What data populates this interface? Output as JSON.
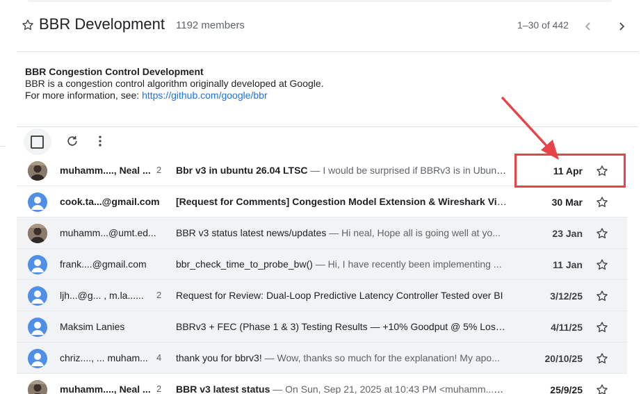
{
  "header": {
    "title": "BBR Development",
    "members": "1192 members",
    "range": "1–30 of 442"
  },
  "about": {
    "title": "BBR Congestion Control Development",
    "line1": "BBR is a congestion control algorithm originally developed at Google.",
    "line2_prefix": "For more information, see: ",
    "link": "https://github.com/google/bbr"
  },
  "icons": {
    "favorite": "star-outline-icon",
    "prev": "chevron-left-icon",
    "next": "chevron-right-icon",
    "refresh": "refresh-icon",
    "more": "more-vert-icon",
    "avatar": "person-icon"
  },
  "colors": {
    "link": "#1a73e8",
    "avatar_default": "#4f8fe8",
    "highlight": "#e8434a"
  },
  "threads": [
    {
      "sender": "muhamm...., Neal ...",
      "count": "2",
      "subject": "Bbr v3 in ubuntu 26.04 LTSC",
      "snippet": " — I would be surprised if BBRv3 is in Ubunt...",
      "date": "11 Apr",
      "unread": true,
      "avatar": "photo"
    },
    {
      "sender": "cook.ta...@gmail.com",
      "count": "",
      "subject": "[Request for Comments] Congestion Model Extension & Wireshark Visuali",
      "snippet": "",
      "date": "30 Mar",
      "unread": true,
      "avatar": "default"
    },
    {
      "sender": "muhamm...@umt.ed...",
      "count": "",
      "subject": "BBR v3 status latest news/updates",
      "snippet": " — Hi neal, Hope all is going well at yo...",
      "date": "23 Jan",
      "unread": false,
      "avatar": "photo"
    },
    {
      "sender": "frank....@gmail.com",
      "count": "",
      "subject": "bbr_check_time_to_probe_bw()",
      "snippet": " — Hi, I have recently been implementing ...",
      "date": "11 Jan",
      "unread": false,
      "avatar": "default"
    },
    {
      "sender": "ljh...@g...  , m.la......",
      "count": "2",
      "subject": "Request for Review: Dual-Loop Predictive Latency Controller Tested over BI",
      "snippet": "",
      "date": "3/12/25",
      "unread": false,
      "avatar": "default"
    },
    {
      "sender": "Maksim Lanies",
      "count": "",
      "subject": "BBRv3 + FEC (Phase 1 & 3) Testing Results — +10% Goodput @ 5% Loss ...",
      "snippet": "",
      "date": "4/11/25",
      "unread": false,
      "avatar": "default"
    },
    {
      "sender": "chriz...., ... muham...",
      "count": "4",
      "subject": "thank you for bbrv3!",
      "snippet": " — Wow, thanks so much for the explanation! My apo...",
      "date": "20/10/25",
      "unread": false,
      "avatar": "default"
    },
    {
      "sender": "muhamm...., Neal ...",
      "count": "2",
      "subject": "BBR v3 latest status",
      "snippet": " — On Sun, Sep 21, 2025 at 10:43 PM <muhamm...@...",
      "date": "25/9/25",
      "unread": true,
      "avatar": "photo"
    }
  ]
}
